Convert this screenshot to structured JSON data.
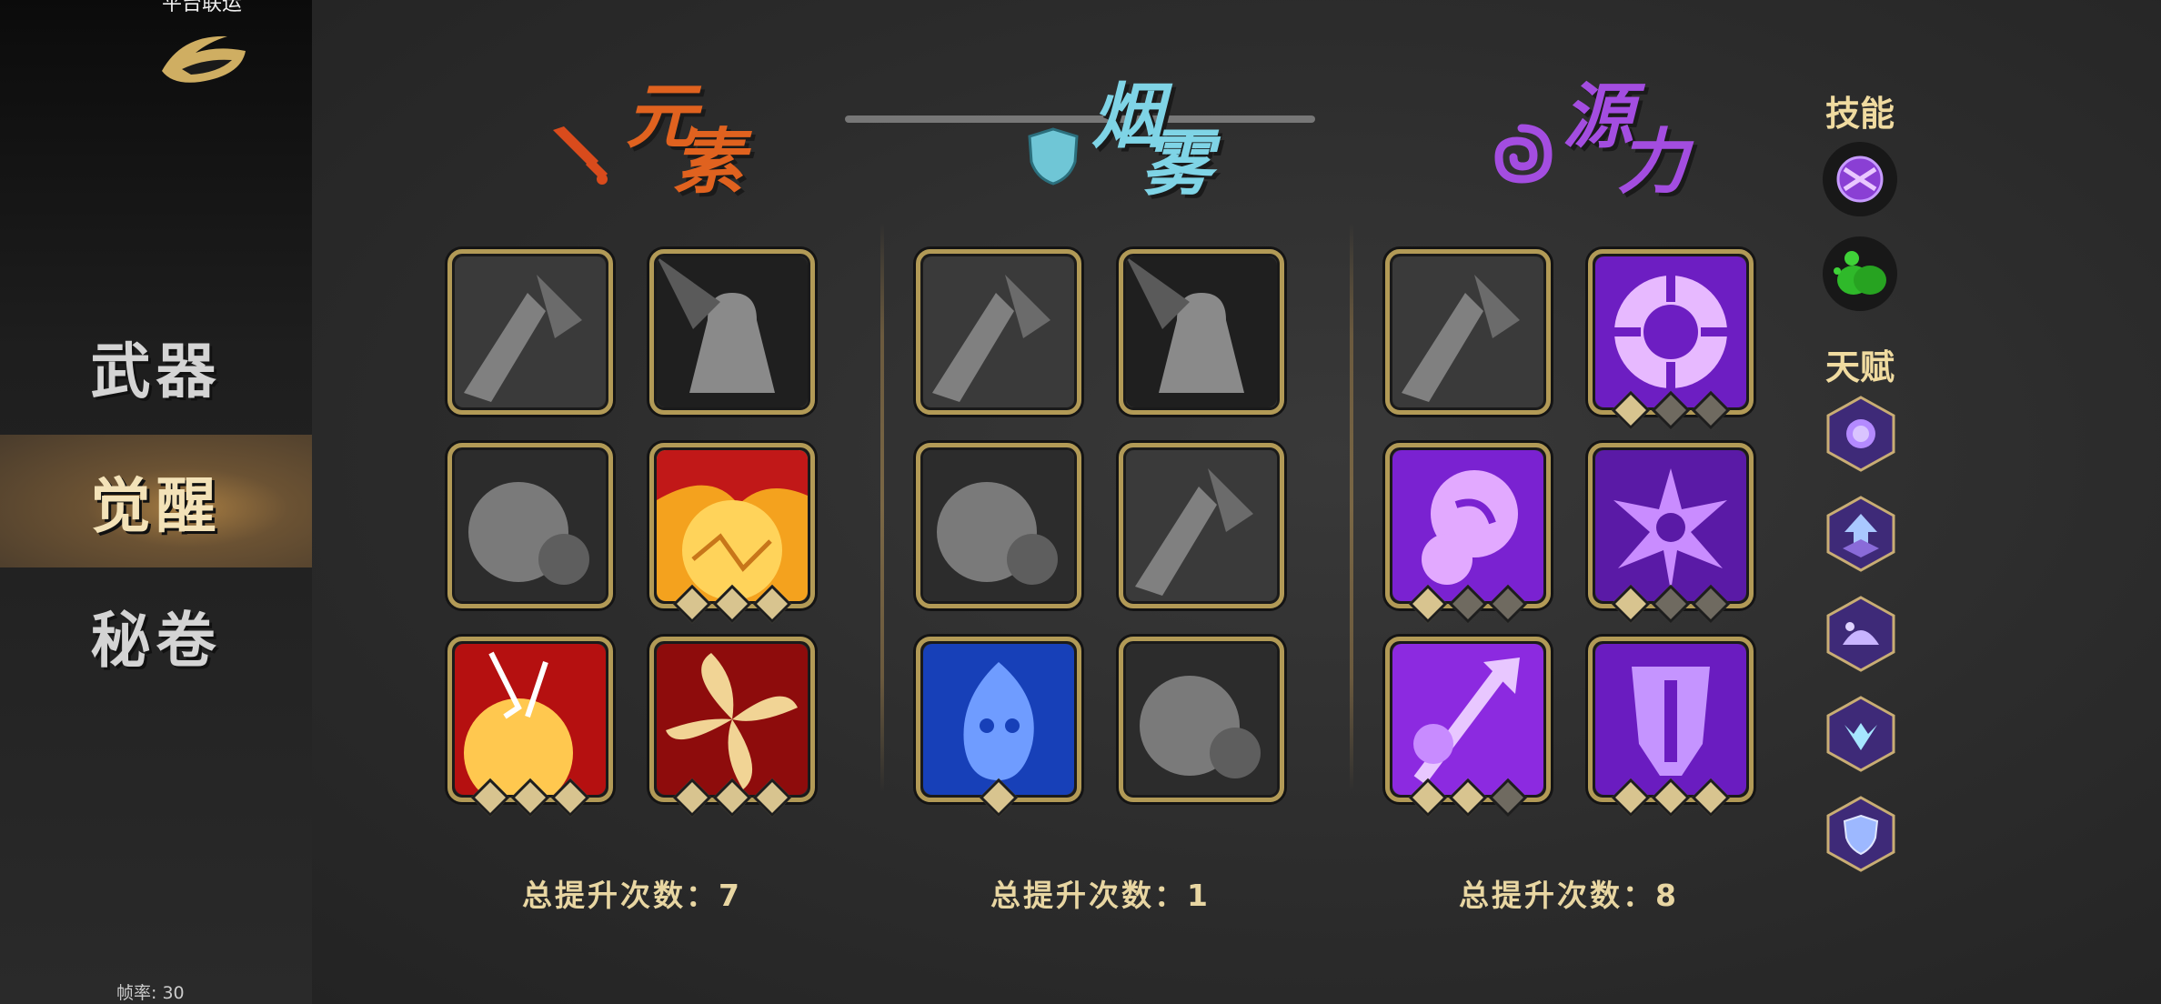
{
  "sidebar": {
    "top_text": "平台联运",
    "nav": [
      {
        "label": "武器",
        "active": false
      },
      {
        "label": "觉醒",
        "active": true
      },
      {
        "label": "秘卷",
        "active": false
      }
    ],
    "fps_label": "帧率: 30"
  },
  "categories": [
    {
      "name_chars": [
        "元",
        "素"
      ],
      "color": "#e0621f",
      "icon": "sword-icon",
      "total_label": "总提升次数：7",
      "skills": [
        {
          "state": "locked",
          "icon": "shatter-icon",
          "diamonds": []
        },
        {
          "state": "locked",
          "icon": "angry-warrior-icon",
          "diamonds": []
        },
        {
          "state": "locked",
          "icon": "explosion-cloud-icon",
          "diamonds": []
        },
        {
          "state": "active",
          "icon": "fire-burst-icon",
          "diamonds": [
            1,
            1,
            1
          ]
        },
        {
          "state": "active",
          "icon": "flame-explosion-icon",
          "diamonds": [
            1,
            1,
            1
          ]
        },
        {
          "state": "active",
          "icon": "fire-swirl-icon",
          "diamonds": [
            1,
            1,
            1
          ]
        }
      ]
    },
    {
      "name_chars": [
        "烟",
        "雾"
      ],
      "color": "#7fd4e6",
      "icon": "shield-icon",
      "total_label": "总提升次数：1",
      "skills": [
        {
          "state": "locked",
          "icon": "bomb-icon",
          "diamonds": []
        },
        {
          "state": "locked",
          "icon": "smoke-mask-icon",
          "diamonds": []
        },
        {
          "state": "locked",
          "icon": "dash-slash-icon",
          "diamonds": []
        },
        {
          "state": "locked",
          "icon": "crouch-figure-icon",
          "diamonds": []
        },
        {
          "state": "active",
          "icon": "ghost-flame-icon",
          "diamonds": [
            1
          ]
        },
        {
          "state": "locked",
          "icon": "bush-icon",
          "diamonds": []
        }
      ]
    },
    {
      "name_chars": [
        "源",
        "力"
      ],
      "color": "#a34de0",
      "icon": "vortex-icon",
      "total_label": "总提升次数：8",
      "skills": [
        {
          "state": "locked",
          "icon": "stopwatch-icon",
          "diamonds": []
        },
        {
          "state": "active",
          "icon": "source-orb-icon",
          "diamonds": [
            1,
            0,
            0
          ]
        },
        {
          "state": "active",
          "icon": "purple-swirl-icon",
          "diamonds": [
            1,
            0,
            0
          ]
        },
        {
          "state": "active",
          "icon": "purple-burst-icon",
          "diamonds": [
            1,
            0,
            0
          ]
        },
        {
          "state": "active",
          "icon": "arrow-wave-icon",
          "diamonds": [
            1,
            1,
            0
          ]
        },
        {
          "state": "active",
          "icon": "mask-icon",
          "diamonds": [
            1,
            1,
            1
          ]
        }
      ]
    }
  ],
  "right_panel": {
    "skills_label": "技能",
    "talents_label": "天赋",
    "skill_icons": [
      "purple-orb-icon",
      "green-slime-icon"
    ],
    "talent_icons": [
      "orb-talent-icon",
      "arrow-up-talent-icon",
      "dome-talent-icon",
      "crystal-talent-icon",
      "shield-talent-icon"
    ]
  },
  "colors": {
    "gold_border": "#b29a56",
    "gold_text": "#e8d6a2",
    "diamond_on": "#d8c48f",
    "diamond_off": "#6f6a60"
  }
}
